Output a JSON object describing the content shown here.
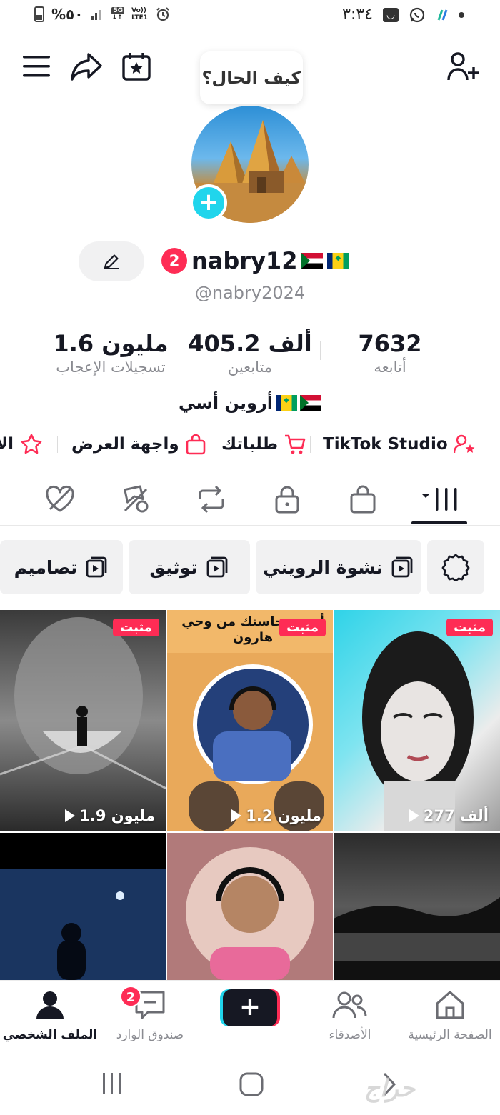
{
  "status_bar": {
    "percent_symbol": "%",
    "percent_value": "٥٠",
    "network_gen": "5G",
    "network_volte": "Vo))",
    "network_lte": "LTE1",
    "time": "٣:٣٤"
  },
  "top_bar": {
    "icons": [
      "menu-icon",
      "share-icon",
      "calendar-star-icon",
      "add-user-icon"
    ]
  },
  "tooltip": {
    "text": "كيف الحال؟"
  },
  "profile": {
    "avatar_plus": "+",
    "notification_count": "2",
    "display_name": "nabry12",
    "handle": "@nabry2024",
    "bio": "أروين أسي"
  },
  "stats": {
    "following": {
      "value": "7632",
      "label": "أتابعه"
    },
    "followers": {
      "value": "405.2 ألف",
      "label": "متابعين"
    },
    "likes": {
      "value": "1.6 مليون",
      "label": "تسجيلات الإعجاب"
    }
  },
  "links": [
    {
      "label": "TikTok Studio",
      "icon": "studio-icon"
    },
    {
      "label": "طلباتك",
      "icon": "cart-icon"
    },
    {
      "label": "واجهة العرض",
      "icon": "bag-icon"
    },
    {
      "label": "الا",
      "icon": "star-badge-icon"
    }
  ],
  "content_tabs": [
    "videos-grid-icon",
    "shop-icon",
    "lock-icon",
    "repost-icon",
    "favorites-icon",
    "liked-icon"
  ],
  "playlists": [
    {
      "label": "نشوة الرويني"
    },
    {
      "label": "توثيق"
    },
    {
      "label": "تصاميم"
    }
  ],
  "videos": [
    {
      "pinned": "مثبت",
      "views": "277 ألف"
    },
    {
      "pinned": "مثبت",
      "views": "1.2 مليون",
      "caption": "أنس محاسنك من وحي هارون"
    },
    {
      "pinned": "مثبت",
      "views": "1.9 مليون"
    },
    {
      "views": ""
    },
    {
      "views": ""
    },
    {
      "views": ""
    }
  ],
  "bottom_nav": {
    "home": "الصفحة الرئيسية",
    "friends": "الأصدقاء",
    "create": "+",
    "inbox": "صندوق الوارد",
    "inbox_badge": "2",
    "profile": "الملف الشخصي"
  },
  "watermark": "حراج",
  "colors": {
    "accent_red": "#fe2c55",
    "accent_cyan": "#20d5ec",
    "text_primary": "#161823",
    "text_secondary": "#8a8b91"
  }
}
